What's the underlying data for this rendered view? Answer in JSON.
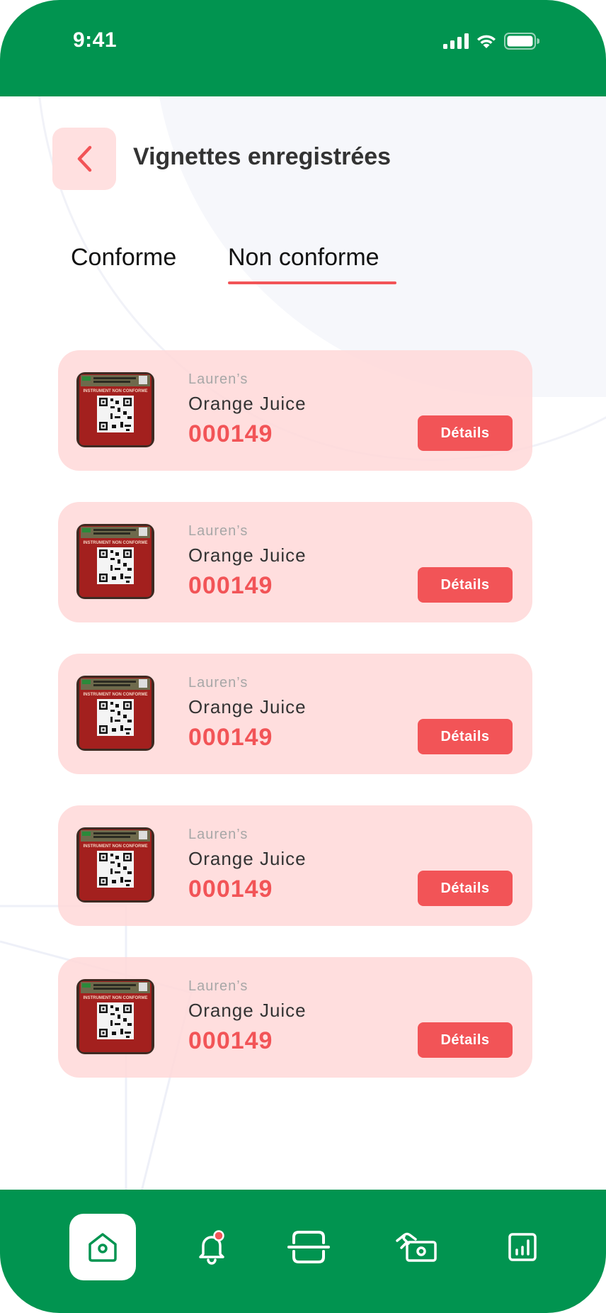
{
  "status_bar": {
    "time": "9:41"
  },
  "header": {
    "title": "Vignettes enregistrées"
  },
  "tabs": [
    {
      "label": "Conforme",
      "active": false
    },
    {
      "label": "Non conforme",
      "active": true
    }
  ],
  "items": [
    {
      "brand": "Lauren’s",
      "product": "Orange Juice",
      "code": "000149",
      "button": "Détails",
      "label_text": "INSTRUMENT NON CONFORME"
    },
    {
      "brand": "Lauren’s",
      "product": "Orange Juice",
      "code": "000149",
      "button": "Détails",
      "label_text": "INSTRUMENT NON CONFORME"
    },
    {
      "brand": "Lauren’s",
      "product": "Orange Juice",
      "code": "000149",
      "button": "Détails",
      "label_text": "INSTRUMENT NON CONFORME"
    },
    {
      "brand": "Lauren’s",
      "product": "Orange Juice",
      "code": "000149",
      "button": "Détails",
      "label_text": "INSTRUMENT NON CONFORME"
    },
    {
      "brand": "Lauren’s",
      "product": "Orange Juice",
      "code": "000149",
      "button": "Détails",
      "label_text": "INSTRUMENT NON CONFORME"
    }
  ],
  "bottom_nav": [
    {
      "icon": "home-icon",
      "active": true
    },
    {
      "icon": "bell-icon",
      "active": false,
      "badge": true
    },
    {
      "icon": "scan-icon",
      "active": false
    },
    {
      "icon": "payment-icon",
      "active": false
    },
    {
      "icon": "stats-icon",
      "active": false
    }
  ],
  "colors": {
    "brand_green": "#019450",
    "accent_red": "#f25457",
    "card_bg": "#ffd8d8",
    "back_button_bg": "#ffe0e0"
  }
}
